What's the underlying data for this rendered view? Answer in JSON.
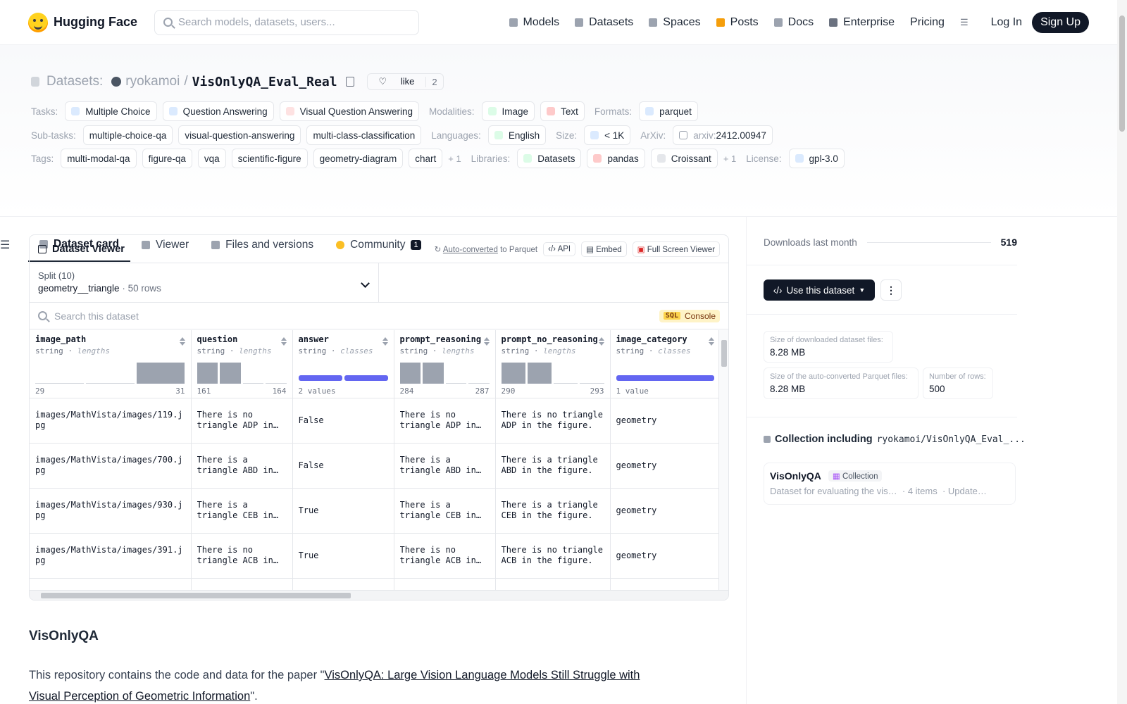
{
  "nav": {
    "brand": "Hugging Face",
    "search_placeholder": "Search models, datasets, users...",
    "links": [
      {
        "label": "Models",
        "icon": "cube-icon",
        "color": "#9ca3af"
      },
      {
        "label": "Datasets",
        "icon": "database-icon",
        "color": "#9ca3af"
      },
      {
        "label": "Spaces",
        "icon": "grid-icon",
        "color": "#9ca3af"
      },
      {
        "label": "Posts",
        "icon": "posts-icon",
        "color": "#f59e0b"
      },
      {
        "label": "Docs",
        "icon": "docs-icon",
        "color": "#9ca3af"
      },
      {
        "label": "Enterprise",
        "icon": "enterprise-icon",
        "color": "#6b7280"
      }
    ],
    "pricing": "Pricing",
    "login": "Log In",
    "signup": "Sign Up"
  },
  "header": {
    "section": "Datasets:",
    "owner": "ryokamoi",
    "sep": "/",
    "repo": "VisOnlyQA_Eval_Real",
    "like_label": "like",
    "like_count": "2",
    "rows": [
      {
        "label": "Tasks:",
        "chips": [
          "Multiple Choice",
          "Question Answering",
          "Visual Question Answering"
        ],
        "label2": "Modalities:",
        "chips2": [
          "Image",
          "Text"
        ],
        "label3": "Formats:",
        "chips3": [
          "parquet"
        ]
      },
      {
        "label": "Sub-tasks:",
        "chips": [
          "multiple-choice-qa",
          "visual-question-answering",
          "multi-class-classification"
        ],
        "label2": "Languages:",
        "chips2": [
          "English"
        ],
        "label3": "Size:",
        "chips3": [
          "< 1K"
        ],
        "label4": "ArXiv:",
        "arxiv_prefix": "arxiv:",
        "arxiv_id": "2412.00947"
      },
      {
        "label": "Tags:",
        "chips": [
          "multi-modal-qa",
          "figure-qa",
          "vqa",
          "scientific-figure",
          "geometry-diagram",
          "chart"
        ],
        "more": "+ 1",
        "label2": "Libraries:",
        "chips2": [
          "Datasets",
          "pandas",
          "Croissant"
        ],
        "more2": "+ 1",
        "label3": "License:",
        "chips3": [
          "gpl-3.0"
        ]
      }
    ]
  },
  "tabs": [
    "Dataset card",
    "Viewer",
    "Files and versions",
    "Community"
  ],
  "community_badge": "1",
  "viewer": {
    "title": "Dataset Viewer",
    "auto_converted": "Auto-converted",
    "to_parquet": "to Parquet",
    "api": "API",
    "embed": "Embed",
    "fullscreen": "Full Screen Viewer",
    "split_label": "Split (10)",
    "split_value": "geometry__triangle",
    "split_rows": "50 rows",
    "search_placeholder": "Search this dataset",
    "sql": "SQL",
    "console": "Console",
    "columns": [
      {
        "name": "image_path",
        "type": "string",
        "kind": "lengths",
        "min": "29",
        "max": "31",
        "hist": [
          0,
          0,
          1
        ]
      },
      {
        "name": "question",
        "type": "string",
        "kind": "lengths",
        "min": "161",
        "max": "164",
        "hist": [
          1,
          1,
          0,
          0
        ]
      },
      {
        "name": "answer",
        "type": "string",
        "kind": "classes",
        "min": "2 values",
        "max": "",
        "classes": 2
      },
      {
        "name": "prompt_reasoning",
        "type": "string",
        "kind": "lengths",
        "min": "284",
        "max": "287",
        "hist": [
          1,
          1,
          0,
          0
        ]
      },
      {
        "name": "prompt_no_reasoning",
        "type": "string",
        "kind": "lengths",
        "min": "290",
        "max": "293",
        "hist": [
          1,
          1,
          0,
          0
        ]
      },
      {
        "name": "image_category",
        "type": "string",
        "kind": "classes",
        "min": "1 value",
        "max": "",
        "classes": 1
      }
    ],
    "rows": [
      [
        "images/MathVista/images/119.jpg",
        "There is no triangle ADP in the figure.",
        "False",
        "There is no triangle ADP in the figure.",
        "There is no triangle ADP in the figure.",
        "geometry"
      ],
      [
        "images/MathVista/images/700.jpg",
        "There is a triangle ABD in the figure.",
        "False",
        "There is a triangle ABD in the figure.",
        "There is a triangle ABD in the figure.",
        "geometry"
      ],
      [
        "images/MathVista/images/930.jpg",
        "There is a triangle CEB in the figure.",
        "True",
        "There is a triangle CEB in the figure.",
        "There is a triangle CEB in the figure.",
        "geometry"
      ],
      [
        "images/MathVista/images/391.jpg",
        "There is no triangle ACB in the figure.",
        "True",
        "There is no triangle ACB in the figure.",
        "There is no triangle ACB in the figure.",
        "geometry"
      ]
    ]
  },
  "card": {
    "heading": "VisOnlyQA",
    "para_prefix": "This repository contains the code and data for the paper \"",
    "para_link": "VisOnlyQA: Large Vision Language Models Still Struggle with Visual Perception of Geometric Information",
    "para_suffix": "\"."
  },
  "sidebar": {
    "downloads_label": "Downloads last month",
    "downloads_value": "519",
    "use_button": "Use this dataset",
    "stats": [
      {
        "label": "Size of downloaded dataset files:",
        "value": "8.28 MB"
      },
      {
        "label": "Size of the auto-converted Parquet files:",
        "value": "8.28 MB"
      },
      {
        "label": "Number of rows:",
        "value": "500"
      }
    ],
    "collection_title": "Collection including",
    "collection_repo": "ryokamoi/VisOnlyQA_Eval_...",
    "collection_name": "VisOnlyQA",
    "collection_tag": "Collection",
    "collection_desc": "Dataset for evaluating the vis…",
    "collection_items": "4 items",
    "collection_updated": "Update…"
  },
  "colors": {
    "accent": "#6366f1",
    "brand": "#ffd21e"
  }
}
